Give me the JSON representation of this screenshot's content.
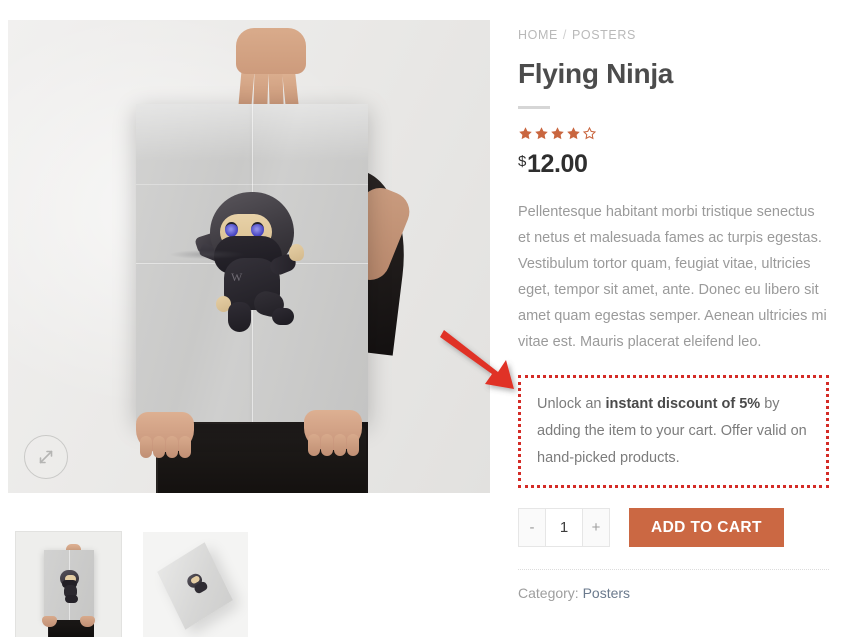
{
  "breadcrumb": {
    "home": "HOME",
    "separator": "/",
    "current": "POSTERS"
  },
  "product": {
    "title": "Flying Ninja",
    "rating_value": 4,
    "rating_max": 5,
    "currency_symbol": "$",
    "price": "12.00",
    "description": "Pellentesque habitant morbi tristique senectus et netus et malesuada fames ac turpis egestas. Vestibulum tortor quam, feugiat vitae, ultricies eget, tempor sit amet, ante. Donec eu libero sit amet quam egestas semper. Aenean ultricies mi vitae est. Mauris placerat eleifend leo."
  },
  "discount_notice": {
    "lead": "Unlock an ",
    "highlight": "instant discount of 5%",
    "trail": " by adding the item to your cart. Offer valid on hand-picked products."
  },
  "cart": {
    "decrease_label": "-",
    "quantity_value": "1",
    "increase_label": "+",
    "add_to_cart_label": "ADD TO CART"
  },
  "meta": {
    "category_label": "Category:",
    "category_value": "Posters"
  },
  "gallery": {
    "expand_icon": "expand-icon",
    "thumbnail_count": 2
  },
  "colors": {
    "accent": "#cb6843",
    "star": "#c9663f",
    "discount_border": "#d42b26",
    "arrow": "#e03127",
    "title": "#4c4c4c",
    "muted_text": "#9a9a9a",
    "link": "#6b7a8d",
    "image_bg": "#ececea"
  }
}
